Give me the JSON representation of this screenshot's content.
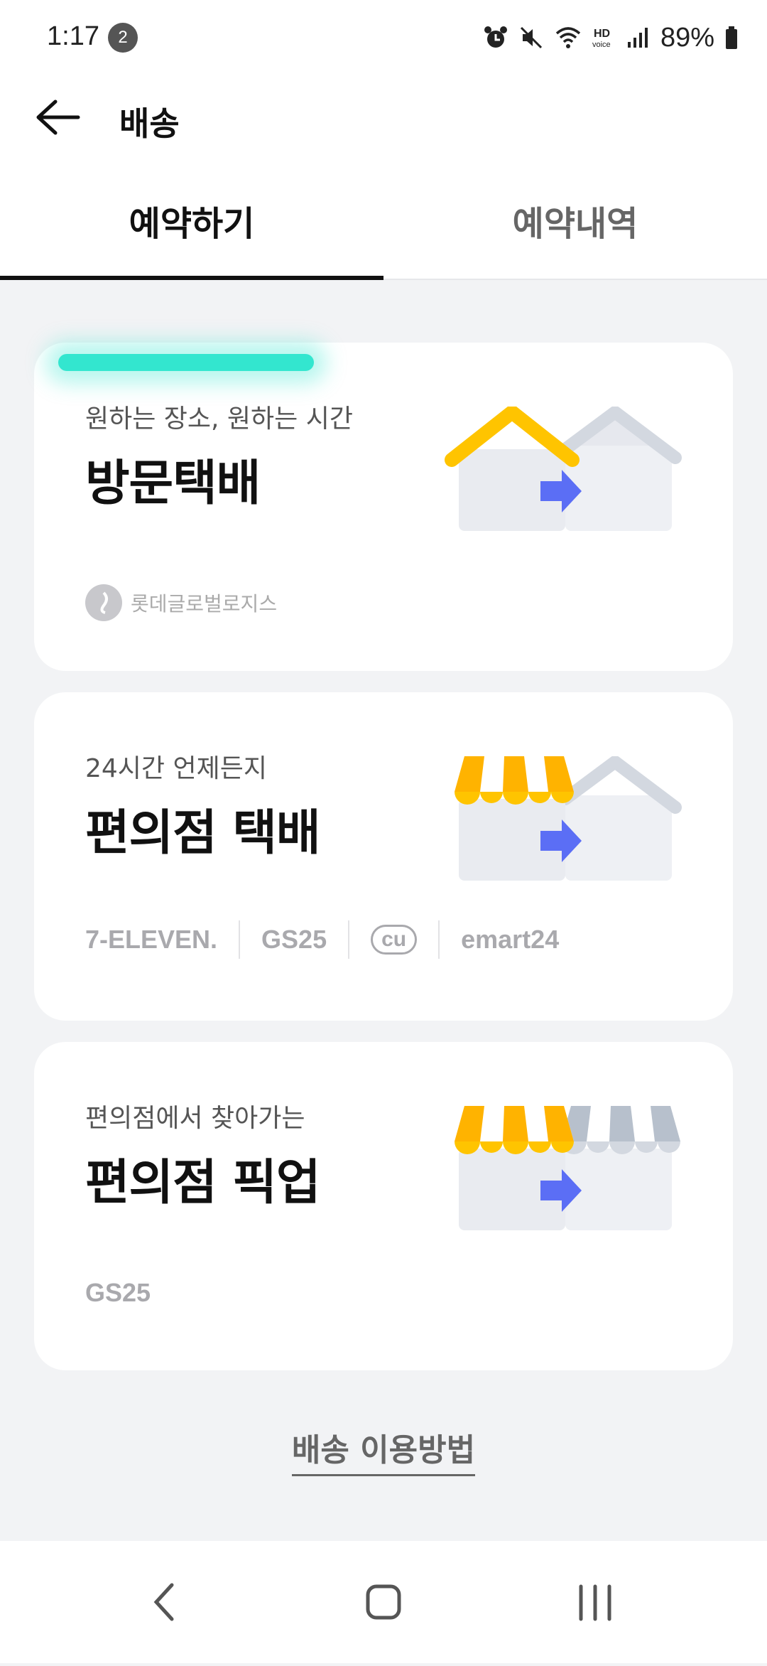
{
  "status_bar": {
    "time": "1:17",
    "notification_count": "2",
    "battery": "89%"
  },
  "header": {
    "title": "배송"
  },
  "tabs": [
    {
      "label": "예약하기",
      "active": true
    },
    {
      "label": "예약내역",
      "active": false
    }
  ],
  "cards": [
    {
      "subtitle": "원하는 장소, 원하는 시간",
      "title": "방문택배",
      "partner": "롯데글로벌로지스"
    },
    {
      "subtitle": "24시간 언제든지",
      "title": "편의점 택배",
      "stores": [
        "7-ELEVEN.",
        "GS25",
        "cu",
        "emart24"
      ]
    },
    {
      "subtitle": "편의점에서 찾아가는",
      "title": "편의점 픽업",
      "stores": [
        "GS25"
      ]
    }
  ],
  "footer_link": "배송 이용방법",
  "colors": {
    "accent_highlight": "#33e6cf",
    "roof_yellow": "#ffc400",
    "arrow_blue": "#5b6ef5",
    "background": "#f2f3f5"
  },
  "icons": [
    "back-arrow-icon",
    "alarm-icon",
    "mute-icon",
    "wifi-icon",
    "hd-voice-icon",
    "signal-icon",
    "battery-icon",
    "nav-back-icon",
    "nav-home-icon",
    "nav-recents-icon"
  ]
}
